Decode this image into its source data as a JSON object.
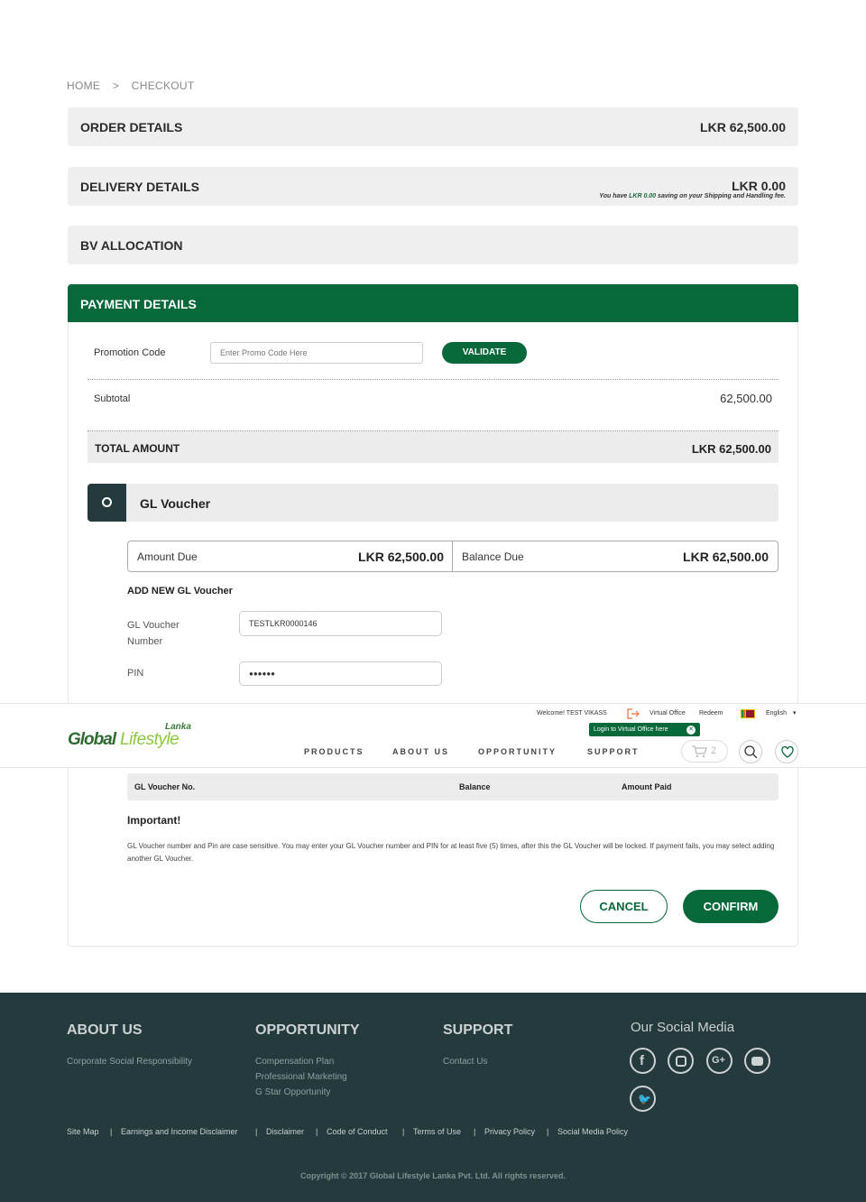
{
  "breadcrumb": {
    "home": "HOME",
    "sep": ">",
    "current": "CHECKOUT"
  },
  "order": {
    "title": "ORDER DETAILS",
    "amount": "LKR 62,500.00"
  },
  "delivery": {
    "title": "DELIVERY DETAILS",
    "amount": "LKR 0.00",
    "note_prefix": "You have",
    "note_value": "LKR 0.00",
    "note_suffix": "saving on your Shipping and Handling fee."
  },
  "bv": {
    "title": "BV ALLOCATION"
  },
  "payment": {
    "title": "PAYMENT DETAILS",
    "promo_label": "Promotion Code",
    "promo_placeholder": "Enter Promo Code Here",
    "validate": "VALIDATE",
    "subtotal_label": "Subtotal",
    "subtotal_value": "62,500.00",
    "total_label": "TOTAL AMOUNT",
    "total_value": "LKR 62,500.00",
    "voucher_title": "GL Voucher",
    "amount_due_label": "Amount Due",
    "amount_due_value": "LKR 62,500.00",
    "balance_due_label": "Balance Due",
    "balance_due_value": "LKR 62,500.00",
    "add_new": "ADD NEW GL Voucher",
    "voucher_number_label_1": "GL Voucher",
    "voucher_number_label_2": "Number",
    "voucher_number_value": "TESTLKR0000146",
    "pin_label": "PIN",
    "pin_value": "●●●●●●",
    "table_headers": [
      "GL Voucher No.",
      "Balance",
      "Amount Paid"
    ],
    "important_title": "Important!",
    "important_text": "GL Voucher number and Pin are case sensitive. You may enter your GL Voucher number and PIN for at least five (5) times, after this the GL Voucher will be locked. If payment fails, you may select adding another GL Voucher.",
    "cancel": "CANCEL",
    "confirm": "CONFIRM"
  },
  "header": {
    "welcome": "Welcome! TEST VIKASS",
    "virtual_office": "Virtual Office",
    "redeem": "Redeem",
    "language": "English",
    "tooltip": "Login to Virtual Office here",
    "logo_small": "Lanka",
    "logo_main_1": "Global",
    "logo_main_2": "Lifestyle",
    "nav": [
      "PRODUCTS",
      "ABOUT US",
      "OPPORTUNITY",
      "SUPPORT"
    ],
    "cart_count": "2",
    "icons": [
      "logout-icon",
      "flag-icon",
      "cart-icon",
      "search-icon",
      "heart-icon"
    ]
  },
  "footer": {
    "about_title": "ABOUT US",
    "about_links": [
      "Corporate Social Responsibility"
    ],
    "opp_title": "OPPORTUNITY",
    "opp_links": [
      "Compensation Plan",
      "Professional Marketing",
      "G Star Opportunity"
    ],
    "support_title": "SUPPORT",
    "support_links": [
      "Contact Us"
    ],
    "social_title": "Our Social Media",
    "social_icons": [
      "facebook-icon",
      "instagram-icon",
      "google-plus-icon",
      "youtube-icon",
      "twitter-icon"
    ],
    "bottom_links": [
      "Site Map",
      "Earnings and Income Disclaimer",
      "Disclaimer",
      "Code of Conduct",
      "Terms of Use",
      "Privacy Policy",
      "Social Media Policy"
    ],
    "copyright": "Copyright © 2017 Global Lifestyle Lanka Pvt. Ltd. All rights reserved."
  },
  "colors": {
    "brand_green": "#07683a",
    "footer_bg": "#243a3d",
    "panel_bg": "#efefef"
  }
}
